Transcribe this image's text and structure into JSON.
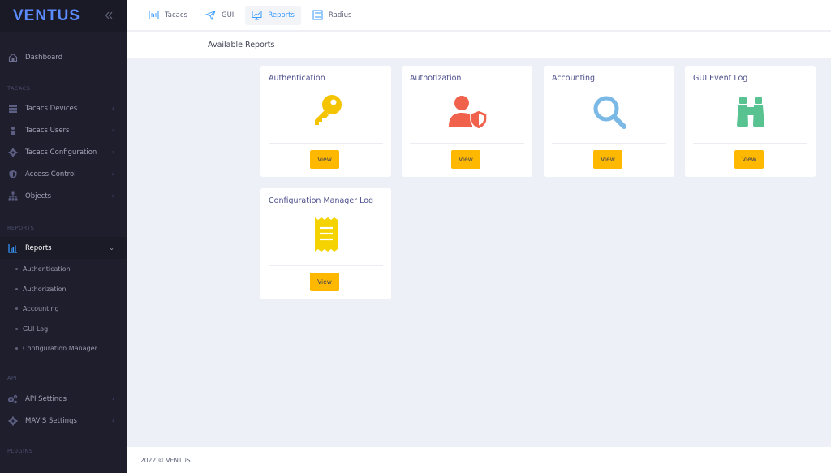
{
  "brand": {
    "name": "VENTUS",
    "toggle_icon": "double-chevron-left-icon"
  },
  "sidebar": {
    "dashboard": "Dashboard",
    "sections": {
      "tacacs": "TACACS",
      "reports": "REPORTS",
      "api": "API",
      "plugins": "PLUGINS"
    },
    "tacacs_items": [
      {
        "label": "Tacacs Devices",
        "icon": "server-icon"
      },
      {
        "label": "Tacacs Users",
        "icon": "user-icon"
      },
      {
        "label": "Tacacs Configuration",
        "icon": "gear-icon"
      },
      {
        "label": "Access Control",
        "icon": "shield-icon"
      },
      {
        "label": "Objects",
        "icon": "hierarchy-icon"
      }
    ],
    "reports_item": {
      "label": "Reports",
      "icon": "chart-icon"
    },
    "reports_sub": [
      "Authentication",
      "Authorization",
      "Accounting",
      "GUI Log",
      "Configuration Manager"
    ],
    "api_items": [
      {
        "label": "API Settings",
        "icon": "gears-icon"
      },
      {
        "label": "MAVIS Settings",
        "icon": "gear-icon"
      }
    ]
  },
  "topnav": {
    "tabs": [
      {
        "label": "Tacacs",
        "icon": "tacacs-icon"
      },
      {
        "label": "GUI",
        "icon": "paper-plane-icon"
      },
      {
        "label": "Reports",
        "icon": "chart-board-icon",
        "active": true
      },
      {
        "label": "Radius",
        "icon": "list-icon"
      }
    ]
  },
  "page": {
    "title": "Available Reports"
  },
  "cards": [
    {
      "title": "Authentication",
      "icon": "key-icon",
      "button": "View"
    },
    {
      "title": "Authotization",
      "icon": "user-shield-icon",
      "button": "View"
    },
    {
      "title": "Accounting",
      "icon": "magnifier-icon",
      "button": "View"
    },
    {
      "title": "GUI Event Log",
      "icon": "binoculars-icon",
      "button": "View"
    },
    {
      "title": "Configuration Manager Log",
      "icon": "receipt-icon",
      "button": "View"
    }
  ],
  "colors": {
    "accent": "#3699ff",
    "button": "#ffb800",
    "sidebar": "#1e1e2d",
    "key": "#f5c400",
    "user": "#f1624c",
    "search": "#7ab8e6",
    "binoculars": "#58c391",
    "receipt": "#f5d300"
  },
  "footer": {
    "text": "2022 © VENTUS"
  }
}
